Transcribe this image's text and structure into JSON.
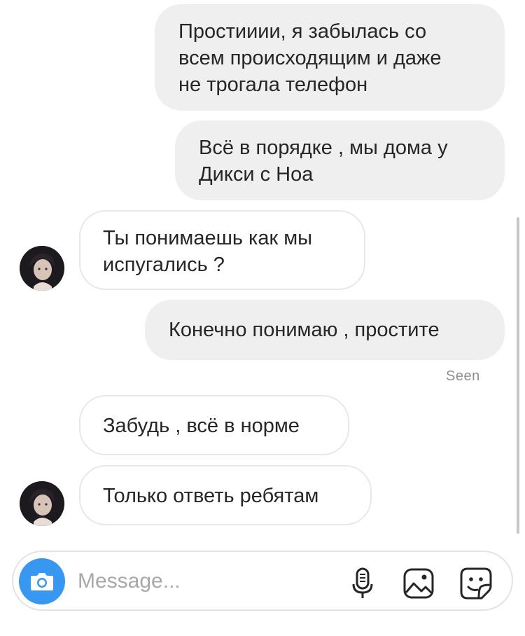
{
  "messages": [
    {
      "id": "m1",
      "direction": "outgoing",
      "text": "Простииии, я забылась со\nвсем происходящим и даже\nне трогала телефон"
    },
    {
      "id": "m2",
      "direction": "outgoing",
      "text": "Всё в порядке , мы дома у\nДикси с Ноа"
    },
    {
      "id": "m3",
      "direction": "incoming",
      "text": "Ты понимаешь как мы\nиспугались ?"
    },
    {
      "id": "m4",
      "direction": "outgoing",
      "text": "Конечно понимаю , простите"
    },
    {
      "id": "m5",
      "direction": "incoming",
      "text": "Забудь , всё в норме"
    },
    {
      "id": "m6",
      "direction": "incoming",
      "text": "Только ответь ребятам"
    }
  ],
  "seen_label": "Seen",
  "composer": {
    "placeholder": "Message...",
    "value": "",
    "icons": [
      "camera-icon",
      "microphone-icon",
      "gallery-icon",
      "sticker-icon"
    ]
  },
  "colors": {
    "outgoing_bubble": "#efefef",
    "incoming_border": "#e8e8e8",
    "camera_button": "#3897f0",
    "seen_text": "#8e8e8e"
  }
}
